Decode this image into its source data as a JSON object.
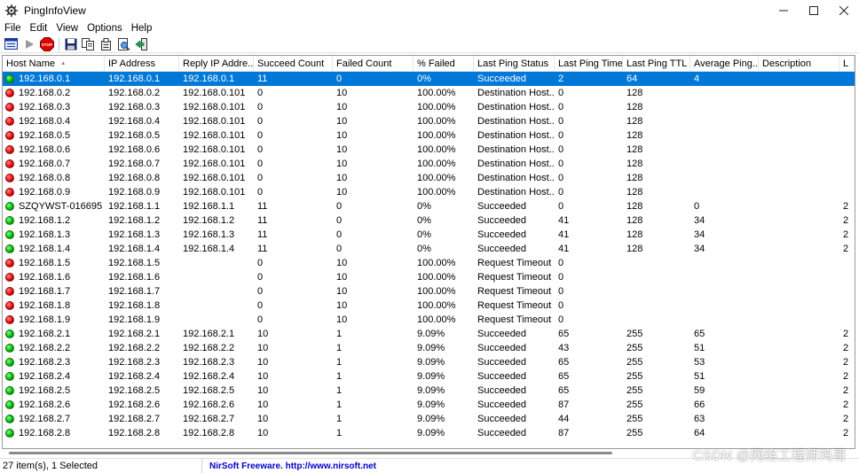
{
  "window": {
    "title": "PingInfoView"
  },
  "menu": [
    "File",
    "Edit",
    "View",
    "Options",
    "Help"
  ],
  "toolbar": {
    "icons": [
      "options-icon",
      "start-icon",
      "stop-icon",
      "save-icon",
      "copy-icon",
      "properties-icon",
      "html-report-icon",
      "exit-icon"
    ],
    "stop_label": "STOP"
  },
  "table": {
    "columns": [
      "Host Name",
      "IP Address",
      "Reply IP Addre...",
      "Succeed Count",
      "Failed Count",
      "% Failed",
      "Last Ping Status",
      "Last Ping Time",
      "Last Ping TTL",
      "Average Ping...",
      "Description",
      "L"
    ],
    "rows": [
      {
        "status": "green",
        "selected": true,
        "cells": [
          "192.168.0.1",
          "192.168.0.1",
          "192.168.0.1",
          "11",
          "0",
          "0%",
          "Succeeded",
          "2",
          "64",
          "4",
          "",
          ""
        ]
      },
      {
        "status": "red",
        "cells": [
          "192.168.0.2",
          "192.168.0.2",
          "192.168.0.101",
          "0",
          "10",
          "100.00%",
          "Destination Host...",
          "0",
          "128",
          "",
          "",
          ""
        ]
      },
      {
        "status": "red",
        "cells": [
          "192.168.0.3",
          "192.168.0.3",
          "192.168.0.101",
          "0",
          "10",
          "100.00%",
          "Destination Host...",
          "0",
          "128",
          "",
          "",
          ""
        ]
      },
      {
        "status": "red",
        "cells": [
          "192.168.0.4",
          "192.168.0.4",
          "192.168.0.101",
          "0",
          "10",
          "100.00%",
          "Destination Host...",
          "0",
          "128",
          "",
          "",
          ""
        ]
      },
      {
        "status": "red",
        "cells": [
          "192.168.0.5",
          "192.168.0.5",
          "192.168.0.101",
          "0",
          "10",
          "100.00%",
          "Destination Host...",
          "0",
          "128",
          "",
          "",
          ""
        ]
      },
      {
        "status": "red",
        "cells": [
          "192.168.0.6",
          "192.168.0.6",
          "192.168.0.101",
          "0",
          "10",
          "100.00%",
          "Destination Host...",
          "0",
          "128",
          "",
          "",
          ""
        ]
      },
      {
        "status": "red",
        "cells": [
          "192.168.0.7",
          "192.168.0.7",
          "192.168.0.101",
          "0",
          "10",
          "100.00%",
          "Destination Host...",
          "0",
          "128",
          "",
          "",
          ""
        ]
      },
      {
        "status": "red",
        "cells": [
          "192.168.0.8",
          "192.168.0.8",
          "192.168.0.101",
          "0",
          "10",
          "100.00%",
          "Destination Host...",
          "0",
          "128",
          "",
          "",
          ""
        ]
      },
      {
        "status": "red",
        "cells": [
          "192.168.0.9",
          "192.168.0.9",
          "192.168.0.101",
          "0",
          "10",
          "100.00%",
          "Destination Host...",
          "0",
          "128",
          "",
          "",
          ""
        ]
      },
      {
        "status": "green",
        "cells": [
          "SZQYWST-016695",
          "192.168.1.1",
          "192.168.1.1",
          "11",
          "0",
          "0%",
          "Succeeded",
          "0",
          "128",
          "0",
          "",
          "2"
        ]
      },
      {
        "status": "green",
        "cells": [
          "192.168.1.2",
          "192.168.1.2",
          "192.168.1.2",
          "11",
          "0",
          "0%",
          "Succeeded",
          "41",
          "128",
          "34",
          "",
          "2"
        ]
      },
      {
        "status": "green",
        "cells": [
          "192.168.1.3",
          "192.168.1.3",
          "192.168.1.3",
          "11",
          "0",
          "0%",
          "Succeeded",
          "41",
          "128",
          "34",
          "",
          "2"
        ]
      },
      {
        "status": "green",
        "cells": [
          "192.168.1.4",
          "192.168.1.4",
          "192.168.1.4",
          "11",
          "0",
          "0%",
          "Succeeded",
          "41",
          "128",
          "34",
          "",
          "2"
        ]
      },
      {
        "status": "red",
        "cells": [
          "192.168.1.5",
          "192.168.1.5",
          "",
          "0",
          "10",
          "100.00%",
          "Request Timeout",
          "0",
          "",
          "",
          "",
          ""
        ]
      },
      {
        "status": "red",
        "cells": [
          "192.168.1.6",
          "192.168.1.6",
          "",
          "0",
          "10",
          "100.00%",
          "Request Timeout",
          "0",
          "",
          "",
          "",
          ""
        ]
      },
      {
        "status": "red",
        "cells": [
          "192.168.1.7",
          "192.168.1.7",
          "",
          "0",
          "10",
          "100.00%",
          "Request Timeout",
          "0",
          "",
          "",
          "",
          ""
        ]
      },
      {
        "status": "red",
        "cells": [
          "192.168.1.8",
          "192.168.1.8",
          "",
          "0",
          "10",
          "100.00%",
          "Request Timeout",
          "0",
          "",
          "",
          "",
          ""
        ]
      },
      {
        "status": "red",
        "cells": [
          "192.168.1.9",
          "192.168.1.9",
          "",
          "0",
          "10",
          "100.00%",
          "Request Timeout",
          "0",
          "",
          "",
          "",
          ""
        ]
      },
      {
        "status": "green",
        "cells": [
          "192.168.2.1",
          "192.168.2.1",
          "192.168.2.1",
          "10",
          "1",
          "9.09%",
          "Succeeded",
          "65",
          "255",
          "65",
          "",
          "2"
        ]
      },
      {
        "status": "green",
        "cells": [
          "192.168.2.2",
          "192.168.2.2",
          "192.168.2.2",
          "10",
          "1",
          "9.09%",
          "Succeeded",
          "43",
          "255",
          "51",
          "",
          "2"
        ]
      },
      {
        "status": "green",
        "cells": [
          "192.168.2.3",
          "192.168.2.3",
          "192.168.2.3",
          "10",
          "1",
          "9.09%",
          "Succeeded",
          "65",
          "255",
          "53",
          "",
          "2"
        ]
      },
      {
        "status": "green",
        "cells": [
          "192.168.2.4",
          "192.168.2.4",
          "192.168.2.4",
          "10",
          "1",
          "9.09%",
          "Succeeded",
          "65",
          "255",
          "51",
          "",
          "2"
        ]
      },
      {
        "status": "green",
        "cells": [
          "192.168.2.5",
          "192.168.2.5",
          "192.168.2.5",
          "10",
          "1",
          "9.09%",
          "Succeeded",
          "65",
          "255",
          "59",
          "",
          "2"
        ]
      },
      {
        "status": "green",
        "cells": [
          "192.168.2.6",
          "192.168.2.6",
          "192.168.2.6",
          "10",
          "1",
          "9.09%",
          "Succeeded",
          "87",
          "255",
          "66",
          "",
          "2"
        ]
      },
      {
        "status": "green",
        "cells": [
          "192.168.2.7",
          "192.168.2.7",
          "192.168.2.7",
          "10",
          "1",
          "9.09%",
          "Succeeded",
          "44",
          "255",
          "63",
          "",
          "2"
        ]
      },
      {
        "status": "green",
        "cells": [
          "192.168.2.8",
          "192.168.2.8",
          "192.168.2.8",
          "10",
          "1",
          "9.09%",
          "Succeeded",
          "87",
          "255",
          "64",
          "",
          "2"
        ]
      }
    ]
  },
  "status": {
    "items_text": "27 item(s), 1 Selected",
    "credit_text": "NirSoft Freeware.  http://www.nirsoft.net"
  },
  "watermark": "CSDN @网络工程师鸡哥"
}
